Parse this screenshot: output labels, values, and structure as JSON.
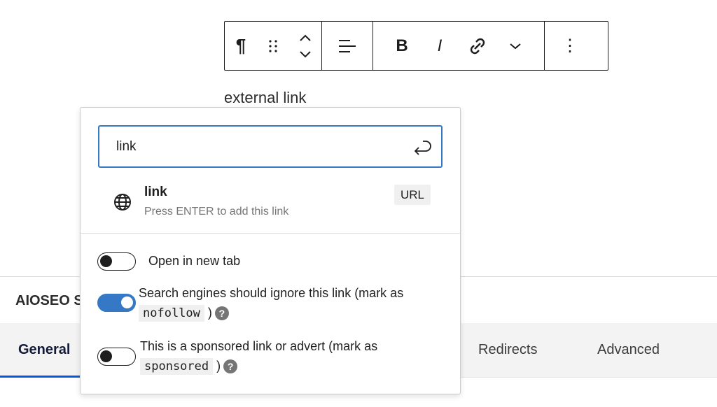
{
  "toolbar": {
    "paragraph": "¶",
    "drag": "⠿",
    "bold": "B",
    "italic": "I",
    "more": "⋮"
  },
  "paragraph_text": "external link",
  "background": {
    "section_title": "AIOSEO S",
    "tabs": [
      {
        "label": "General",
        "active": true
      },
      {
        "label": "Redirects"
      },
      {
        "label": "Advanced"
      }
    ],
    "accent": "#005ae0"
  },
  "link_popover": {
    "input_value": "link",
    "suggestion": {
      "title": "link",
      "subtitle": "Press ENTER to add this link",
      "badge": "URL",
      "icon": "globe-icon"
    },
    "options": [
      {
        "label": "Open in new tab",
        "checked": false
      },
      {
        "label": "Search engines should ignore this link (mark as",
        "code": "nofollow",
        "suffix": ")",
        "checked": true
      },
      {
        "label": "This is a sponsored link or advert (mark as",
        "code": "sponsored",
        "suffix": ")",
        "checked": false
      }
    ],
    "help": "?",
    "accent": "#3478c6"
  }
}
